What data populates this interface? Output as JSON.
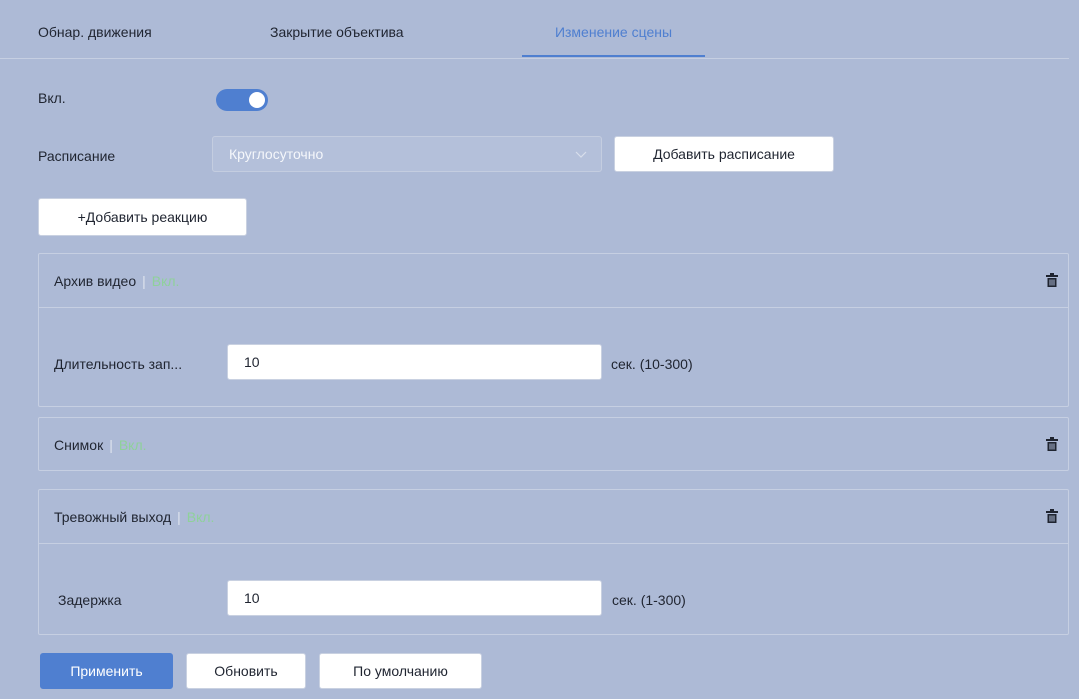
{
  "tabs": [
    {
      "label": "Обнар. движения",
      "active": false
    },
    {
      "label": "Закрытие объектива",
      "active": false
    },
    {
      "label": "Изменение сцены",
      "active": true
    }
  ],
  "enable": {
    "label": "Вкл.",
    "on": true
  },
  "schedule": {
    "label": "Расписание",
    "selected": "Круглосуточно",
    "add_button": "Добавить расписание"
  },
  "add_reaction_button": "+Добавить реакцию",
  "reactions": [
    {
      "title": "Архив видео",
      "status": "Вкл.",
      "field_label": "Длительность зап...",
      "field_value": "10",
      "field_unit": "сек. (10-300)"
    },
    {
      "title": "Снимок",
      "status": "Вкл."
    },
    {
      "title": "Тревожный выход",
      "status": "Вкл.",
      "field_label": "Задержка",
      "field_value": "10",
      "field_unit": "сек. (1-300)"
    }
  ],
  "footer": {
    "apply": "Применить",
    "refresh": "Обновить",
    "default": "По умолчанию"
  },
  "colors": {
    "background": "#adbad6",
    "accent": "#4f7fd0",
    "status_on": "#8fd19a"
  },
  "icons": {
    "trash": "trash-icon",
    "select_arrow": "chevron-down-icon"
  }
}
